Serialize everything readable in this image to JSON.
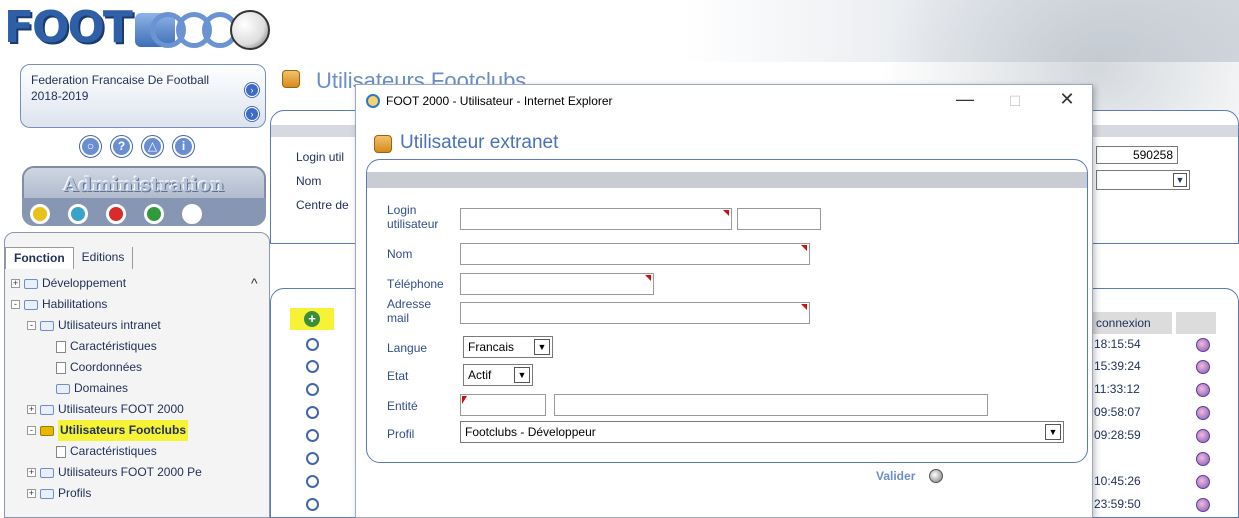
{
  "colors": {
    "accent_blue": "#4a72b8",
    "highlight_yellow": "#f6f336",
    "required_red": "#cc1010",
    "dot_colors": [
      "#e9c21a",
      "#3aa3c8",
      "#d92b2b",
      "#2f9a3a",
      "#ffffff"
    ]
  },
  "sidebar": {
    "federation_name": "Federation Francaise De Football",
    "season": "2018-2019",
    "section_title": "Administration",
    "tabs": [
      "Fonction",
      "Editions"
    ],
    "tree": [
      {
        "label": "Développement",
        "level": 0,
        "type": "folder",
        "expander": "+"
      },
      {
        "label": "Habilitations",
        "level": 0,
        "type": "folder",
        "expander": "-"
      },
      {
        "label": "Utilisateurs intranet",
        "level": 1,
        "type": "folder",
        "expander": "-"
      },
      {
        "label": "Caractéristiques",
        "level": 2,
        "type": "doc"
      },
      {
        "label": "Coordonnées",
        "level": 2,
        "type": "doc"
      },
      {
        "label": "Domaines",
        "level": 2,
        "type": "folder"
      },
      {
        "label": "Utilisateurs FOOT 2000",
        "level": 1,
        "type": "folder",
        "expander": "+"
      },
      {
        "label": "Utilisateurs Footclubs",
        "level": 1,
        "type": "folder",
        "expander": "-",
        "selected": true
      },
      {
        "label": "Caractéristiques",
        "level": 2,
        "type": "doc"
      },
      {
        "label": "Utilisateurs FOOT 2000 Pe",
        "level": 1,
        "type": "folder",
        "expander": "+"
      },
      {
        "label": "Profils",
        "level": 1,
        "type": "folder",
        "expander": "+"
      }
    ]
  },
  "main": {
    "title": "Utilisateurs Footclubs",
    "bg_labels": [
      "Login util",
      "Nom",
      "Centre de"
    ],
    "bg_login_value": "590258",
    "list_header": "connexion",
    "times": [
      "18:15:54",
      "15:39:24",
      "11:33:12",
      "09:58:07",
      "09:28:59",
      "",
      "10:45:26",
      "23:59:50"
    ]
  },
  "dialog": {
    "window_title": "FOOT 2000 - Utilisateur - Internet Explorer",
    "controls": {
      "minimize": "—",
      "maximize": "☐",
      "close": "✕"
    },
    "title": "Utilisateur extranet",
    "fields": {
      "login_label_1": "Login",
      "login_label_2": "utilisateur",
      "nom_label": "Nom",
      "telephone_label": "Téléphone",
      "adresse_label_1": "Adresse",
      "adresse_label_2": "mail",
      "langue_label": "Langue",
      "langue_value": "Francais",
      "etat_label": "Etat",
      "etat_value": "Actif",
      "entite_label": "Entité",
      "profil_label": "Profil",
      "profil_value": "Footclubs - Développeur"
    },
    "submit_label": "Valider"
  }
}
